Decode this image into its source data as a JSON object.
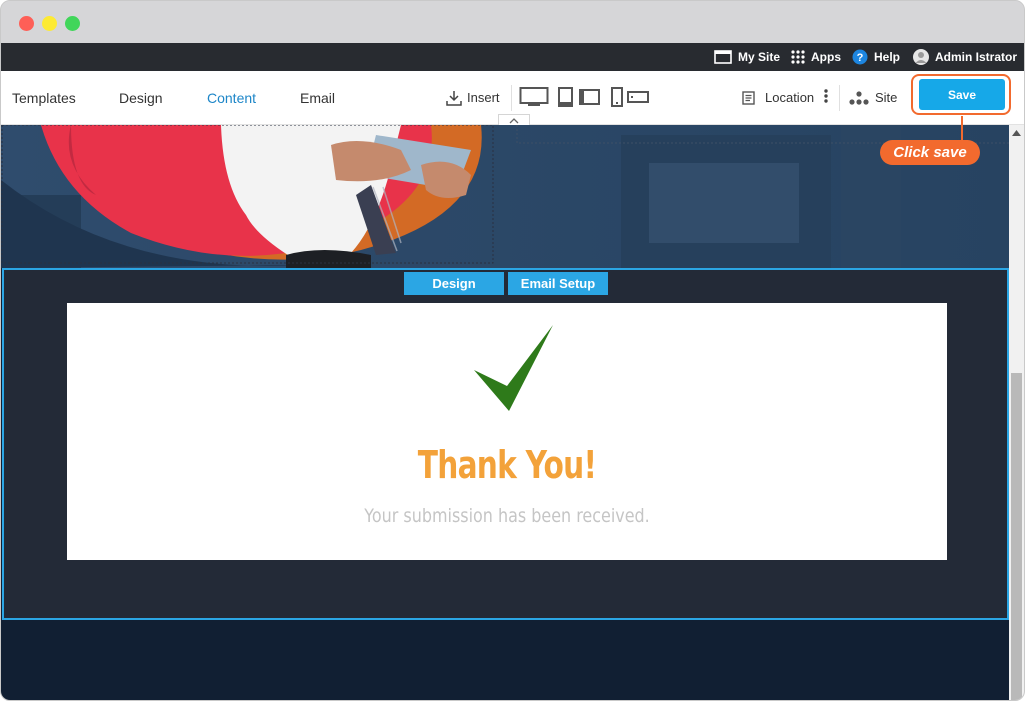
{
  "topbar": {
    "my_site": "My Site",
    "apps": "Apps",
    "help": "Help",
    "user": "Admin Istrator"
  },
  "nav": {
    "templates": "Templates",
    "design": "Design",
    "content": "Content",
    "email": "Email",
    "active": "Content"
  },
  "toolbar": {
    "insert": "Insert",
    "location": "Location",
    "site": "Site",
    "save": "Save"
  },
  "section": {
    "tab_design": "Design",
    "tab_email_setup": "Email Setup"
  },
  "thank_you": {
    "title": "Thank You!",
    "message": "Your submission has been received."
  },
  "annotation": {
    "callout": "Click save"
  },
  "colors": {
    "accent": "#16a8e8",
    "callout": "#f26a2e",
    "check": "#2e7a1a",
    "title": "#f3a23a"
  }
}
